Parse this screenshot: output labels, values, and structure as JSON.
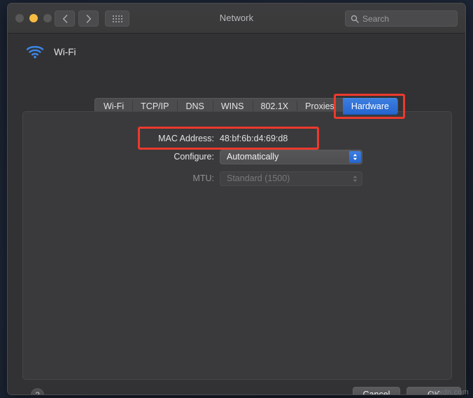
{
  "window": {
    "title": "Network",
    "traffic_lights": [
      {
        "name": "close",
        "color": "#585859"
      },
      {
        "name": "minimize",
        "color": "#f6bb42"
      },
      {
        "name": "zoom",
        "color": "#585859"
      }
    ],
    "back_icon": "chevron-left-icon",
    "forward_icon": "chevron-right-icon",
    "grid_icon": "all-preferences-grid-icon"
  },
  "search": {
    "placeholder": "Search",
    "icon": "search-icon"
  },
  "service": {
    "icon": "wifi-icon",
    "name": "Wi-Fi",
    "icon_color": "#3b87e8"
  },
  "tabs": [
    {
      "label": "Wi-Fi",
      "selected": false
    },
    {
      "label": "TCP/IP",
      "selected": false
    },
    {
      "label": "DNS",
      "selected": false
    },
    {
      "label": "WINS",
      "selected": false
    },
    {
      "label": "802.1X",
      "selected": false
    },
    {
      "label": "Proxies",
      "selected": false
    },
    {
      "label": "Hardware",
      "selected": true
    }
  ],
  "form": {
    "mac": {
      "label": "MAC Address:",
      "value": "48:bf:6b:d4:69:d8"
    },
    "configure": {
      "label": "Configure:",
      "value": "Automatically",
      "enabled": true
    },
    "mtu": {
      "label": "MTU:",
      "value": "Standard (1500)",
      "enabled": false
    }
  },
  "footer": {
    "help_label": "?",
    "cancel_label": "Cancel",
    "ok_label": "OK"
  },
  "annotations": {
    "color": "#ec3a2d",
    "targets": [
      "hardware-tab",
      "mac-address-row"
    ]
  },
  "watermark": "wsxdn.com",
  "colors": {
    "accent_blue": "#2c6fd8",
    "window_bg": "#323234",
    "panel_bg": "#3a3a3c",
    "titlebar_bg": "#3b3b3d"
  }
}
